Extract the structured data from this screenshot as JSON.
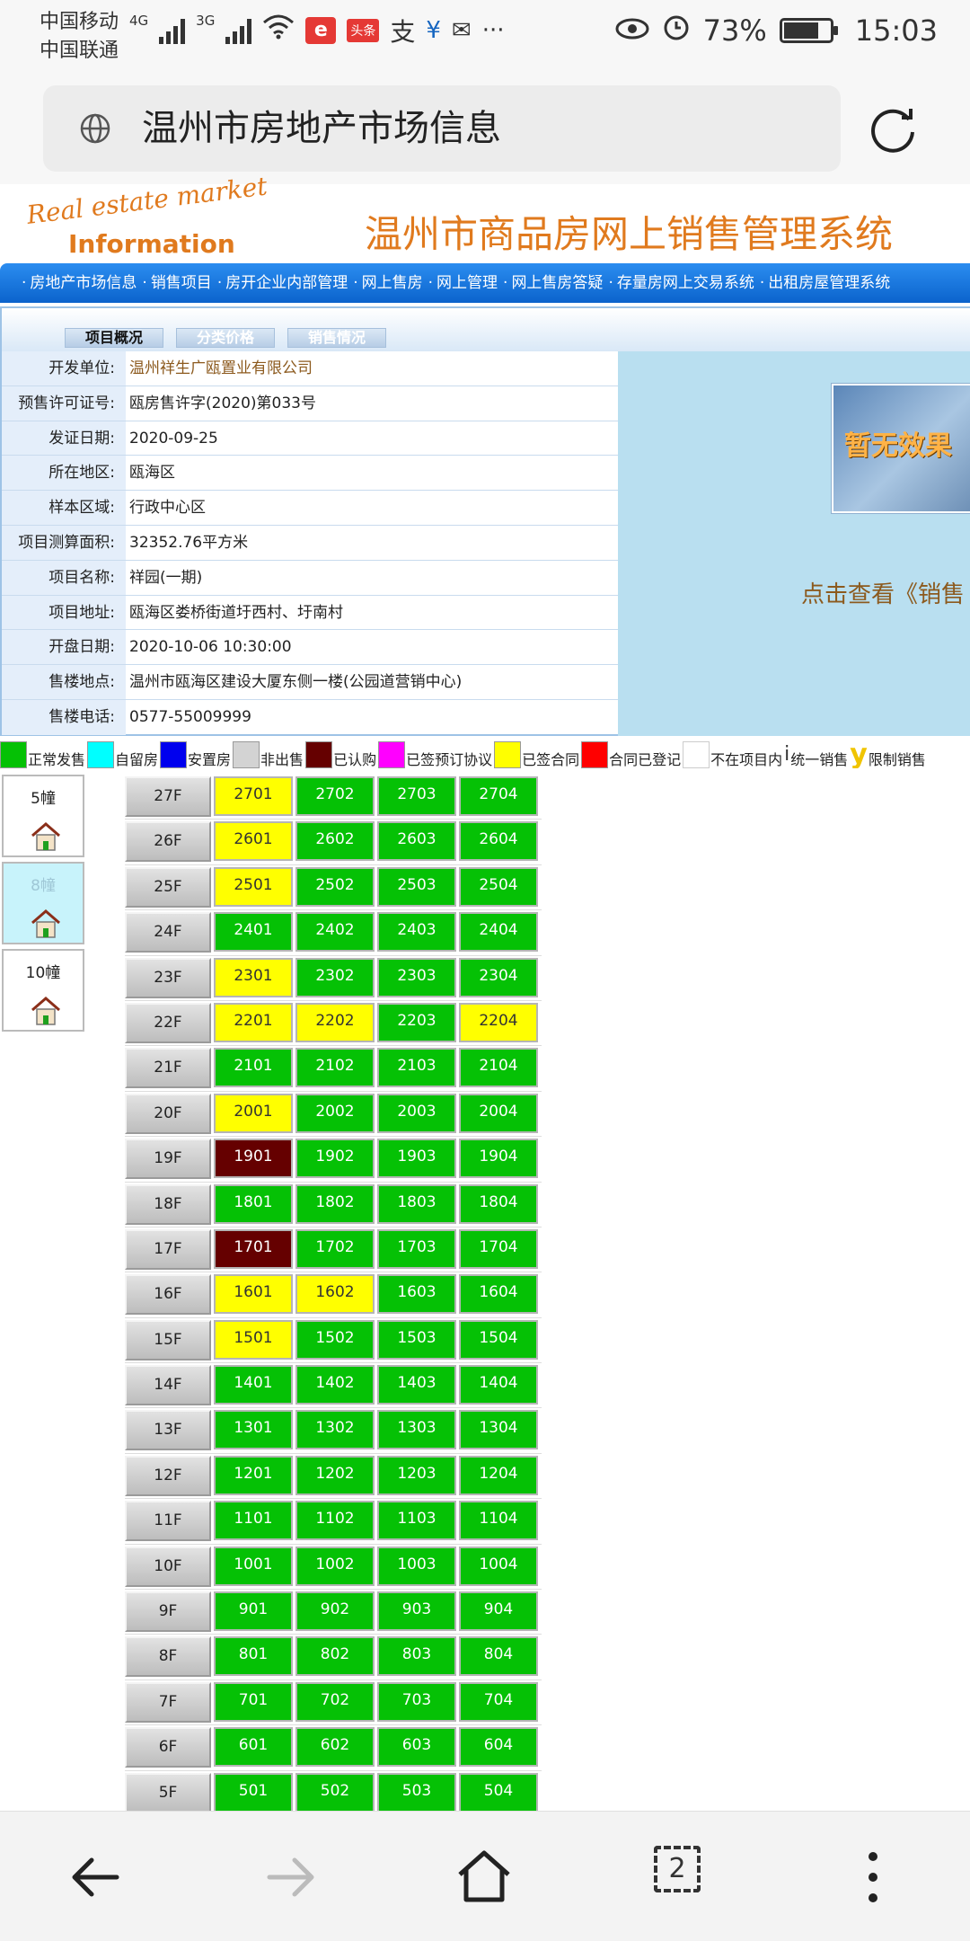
{
  "status_bar": {
    "carrier1": "中国移动",
    "carrier2": "中国联通",
    "net1": "4G",
    "net2": "3G",
    "toutiao_badge": "头条",
    "battery": "73%",
    "time": "15:03",
    "dots": "···"
  },
  "address_bar": {
    "url_title": "温州市房地产市场信息"
  },
  "header": {
    "logo_line1": "Real estate market",
    "logo_line2": "Information",
    "site_title": "温州市商品房网上销售管理系统"
  },
  "nav": {
    "items": [
      "房地产市场信息",
      "销售项目",
      "房开企业内部管理",
      "网上售房",
      "网上管理",
      "网上售房答疑",
      "存量房网上交易系统",
      "出租房屋管理系统"
    ]
  },
  "info": {
    "tabs": [
      "项目概况",
      "分类价格",
      "销售情况"
    ],
    "rows": [
      {
        "label": "开发单位:",
        "value": "温州祥生广瓯置业有限公司"
      },
      {
        "label": "预售许可证号:",
        "value": "瓯房售许字(2020)第033号"
      },
      {
        "label": "发证日期:",
        "value": "2020-09-25"
      },
      {
        "label": "所在地区:",
        "value": "瓯海区"
      },
      {
        "label": "样本区域:",
        "value": "行政中心区"
      },
      {
        "label": "项目测算面积:",
        "value": "32352.76平方米"
      },
      {
        "label": "项目名称:",
        "value": "祥园(一期)"
      },
      {
        "label": "项目地址:",
        "value": "瓯海区娄桥街道圩西村、圩南村"
      },
      {
        "label": "开盘日期:",
        "value": "2020-10-06 10:30:00"
      },
      {
        "label": "售楼地点:",
        "value": "温州市瓯海区建设大厦东侧一楼(公园道营销中心)"
      },
      {
        "label": "售楼电话:",
        "value": "0577-55009999"
      }
    ],
    "promo_image_text": "暂无效果",
    "promo_link": "点击查看《销售"
  },
  "legend": [
    {
      "label": "正常发售",
      "color": "#05c105"
    },
    {
      "label": "自留房",
      "color": "#00ffff"
    },
    {
      "label": "安置房",
      "color": "#0000ee"
    },
    {
      "label": "非出售",
      "color": "#d3d3d3"
    },
    {
      "label": "已认购",
      "color": "#650000"
    },
    {
      "label": "已签预订协议",
      "color": "#ff00ff"
    },
    {
      "label": "已签合同",
      "color": "#ffff00"
    },
    {
      "label": "合同已登记",
      "color": "#ff0000"
    },
    {
      "label": "不在项目内",
      "color": "#ffffff"
    },
    {
      "label": "统一销售",
      "glyph": "i"
    },
    {
      "label": "限制销售",
      "glyph": "y"
    }
  ],
  "buildings": [
    {
      "name": "5幢",
      "active": false
    },
    {
      "name": "8幢",
      "active": true
    },
    {
      "name": "10幢",
      "active": false
    }
  ],
  "floors": [
    {
      "floor": "27F",
      "units": [
        [
          "2701",
          "yellow"
        ],
        [
          "2702",
          "green"
        ],
        [
          "2703",
          "green"
        ],
        [
          "2704",
          "green"
        ]
      ]
    },
    {
      "floor": "26F",
      "units": [
        [
          "2601",
          "yellow"
        ],
        [
          "2602",
          "green"
        ],
        [
          "2603",
          "green"
        ],
        [
          "2604",
          "green"
        ]
      ]
    },
    {
      "floor": "25F",
      "units": [
        [
          "2501",
          "yellow"
        ],
        [
          "2502",
          "green"
        ],
        [
          "2503",
          "green"
        ],
        [
          "2504",
          "green"
        ]
      ]
    },
    {
      "floor": "24F",
      "units": [
        [
          "2401",
          "green"
        ],
        [
          "2402",
          "green"
        ],
        [
          "2403",
          "green"
        ],
        [
          "2404",
          "green"
        ]
      ]
    },
    {
      "floor": "23F",
      "units": [
        [
          "2301",
          "yellow"
        ],
        [
          "2302",
          "green"
        ],
        [
          "2303",
          "green"
        ],
        [
          "2304",
          "green"
        ]
      ]
    },
    {
      "floor": "22F",
      "units": [
        [
          "2201",
          "yellow"
        ],
        [
          "2202",
          "yellow"
        ],
        [
          "2203",
          "green"
        ],
        [
          "2204",
          "yellow"
        ]
      ]
    },
    {
      "floor": "21F",
      "units": [
        [
          "2101",
          "green"
        ],
        [
          "2102",
          "green"
        ],
        [
          "2103",
          "green"
        ],
        [
          "2104",
          "green"
        ]
      ]
    },
    {
      "floor": "20F",
      "units": [
        [
          "2001",
          "yellow"
        ],
        [
          "2002",
          "green"
        ],
        [
          "2003",
          "green"
        ],
        [
          "2004",
          "green"
        ]
      ]
    },
    {
      "floor": "19F",
      "units": [
        [
          "1901",
          "maroon"
        ],
        [
          "1902",
          "green"
        ],
        [
          "1903",
          "green"
        ],
        [
          "1904",
          "green"
        ]
      ]
    },
    {
      "floor": "18F",
      "units": [
        [
          "1801",
          "green"
        ],
        [
          "1802",
          "green"
        ],
        [
          "1803",
          "green"
        ],
        [
          "1804",
          "green"
        ]
      ]
    },
    {
      "floor": "17F",
      "units": [
        [
          "1701",
          "maroon"
        ],
        [
          "1702",
          "green"
        ],
        [
          "1703",
          "green"
        ],
        [
          "1704",
          "green"
        ]
      ]
    },
    {
      "floor": "16F",
      "units": [
        [
          "1601",
          "yellow"
        ],
        [
          "1602",
          "yellow"
        ],
        [
          "1603",
          "green"
        ],
        [
          "1604",
          "green"
        ]
      ]
    },
    {
      "floor": "15F",
      "units": [
        [
          "1501",
          "yellow"
        ],
        [
          "1502",
          "green"
        ],
        [
          "1503",
          "green"
        ],
        [
          "1504",
          "green"
        ]
      ]
    },
    {
      "floor": "14F",
      "units": [
        [
          "1401",
          "green"
        ],
        [
          "1402",
          "green"
        ],
        [
          "1403",
          "green"
        ],
        [
          "1404",
          "green"
        ]
      ]
    },
    {
      "floor": "13F",
      "units": [
        [
          "1301",
          "green"
        ],
        [
          "1302",
          "green"
        ],
        [
          "1303",
          "green"
        ],
        [
          "1304",
          "green"
        ]
      ]
    },
    {
      "floor": "12F",
      "units": [
        [
          "1201",
          "green"
        ],
        [
          "1202",
          "green"
        ],
        [
          "1203",
          "green"
        ],
        [
          "1204",
          "green"
        ]
      ]
    },
    {
      "floor": "11F",
      "units": [
        [
          "1101",
          "green"
        ],
        [
          "1102",
          "green"
        ],
        [
          "1103",
          "green"
        ],
        [
          "1104",
          "green"
        ]
      ]
    },
    {
      "floor": "10F",
      "units": [
        [
          "1001",
          "green"
        ],
        [
          "1002",
          "green"
        ],
        [
          "1003",
          "green"
        ],
        [
          "1004",
          "green"
        ]
      ]
    },
    {
      "floor": "9F",
      "units": [
        [
          "901",
          "green"
        ],
        [
          "902",
          "green"
        ],
        [
          "903",
          "green"
        ],
        [
          "904",
          "green"
        ]
      ]
    },
    {
      "floor": "8F",
      "units": [
        [
          "801",
          "green"
        ],
        [
          "802",
          "green"
        ],
        [
          "803",
          "green"
        ],
        [
          "804",
          "green"
        ]
      ]
    },
    {
      "floor": "7F",
      "units": [
        [
          "701",
          "green"
        ],
        [
          "702",
          "green"
        ],
        [
          "703",
          "green"
        ],
        [
          "704",
          "green"
        ]
      ]
    },
    {
      "floor": "6F",
      "units": [
        [
          "601",
          "green"
        ],
        [
          "602",
          "green"
        ],
        [
          "603",
          "green"
        ],
        [
          "604",
          "green"
        ]
      ]
    },
    {
      "floor": "5F",
      "units": [
        [
          "501",
          "green"
        ],
        [
          "502",
          "green"
        ],
        [
          "503",
          "green"
        ],
        [
          "504",
          "green"
        ]
      ]
    }
  ],
  "bottom_nav": {
    "tab_count": "2"
  }
}
